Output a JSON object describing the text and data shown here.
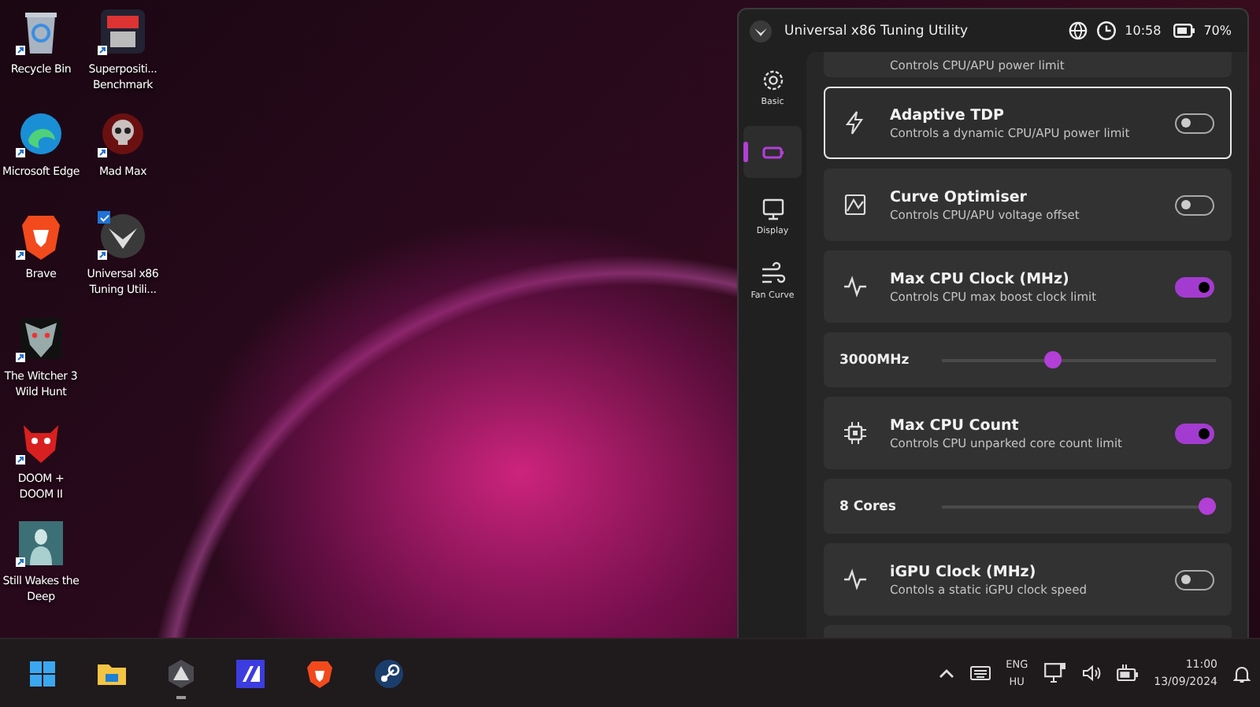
{
  "desktop": {
    "columns": [
      [
        {
          "label": "Recycle Bin",
          "selected": false
        },
        {
          "label": "Microsoft Edge",
          "selected": false
        },
        {
          "label": "Brave",
          "selected": false
        },
        {
          "label": "The Witcher 3 Wild Hunt",
          "selected": false
        },
        {
          "label": "DOOM + DOOM II",
          "selected": false
        },
        {
          "label": "Still Wakes the Deep",
          "selected": false
        }
      ],
      [
        {
          "label": "Superpositi... Benchmark",
          "selected": false
        },
        {
          "label": "Mad Max",
          "selected": false
        },
        {
          "label": "Universal x86 Tuning Utili...",
          "selected": true
        }
      ]
    ]
  },
  "window": {
    "title": "Universal x86 Tuning Utility",
    "time": "10:58",
    "battery": "70%",
    "sidebar": [
      {
        "label": "Basic",
        "selected": false
      },
      {
        "selected": true
      },
      {
        "label": "Display",
        "selected": false
      },
      {
        "label": "Fan Curve",
        "selected": false
      }
    ],
    "settings": [
      {
        "kind": "partial",
        "subtitle": "Controls CPU/APU power limit"
      },
      {
        "kind": "toggle",
        "title": "Adaptive TDP",
        "subtitle": "Controls a dynamic CPU/APU power limit",
        "on": false,
        "focused": true
      },
      {
        "kind": "toggle",
        "title": "Curve Optimiser",
        "subtitle": "Controls CPU/APU voltage offset",
        "on": false,
        "focused": false
      },
      {
        "kind": "toggle",
        "title": "Max CPU Clock (MHz)",
        "subtitle": "Controls CPU max boost clock limit",
        "on": true,
        "focused": false
      },
      {
        "kind": "slider",
        "reading": "3000MHz",
        "level": 0.4
      },
      {
        "kind": "toggle",
        "title": "Max CPU Count",
        "subtitle": "Controls CPU unparked core count limit",
        "on": true,
        "focused": false
      },
      {
        "kind": "slider",
        "reading": "8 Cores",
        "level": 1
      },
      {
        "kind": "toggle",
        "title": "iGPU Clock (MHz)",
        "subtitle": "Contols a static iGPU clock speed",
        "on": false,
        "focused": false
      },
      {
        "kind": "empty"
      }
    ]
  },
  "taskbar": {
    "apps": [
      {
        "running": false
      },
      {
        "running": false
      },
      {
        "running": true
      },
      {
        "running": false
      },
      {
        "running": false
      },
      {
        "running": false
      }
    ],
    "language": "ENG",
    "region": "HU",
    "clock": "11:00",
    "date": "13/09/2024"
  }
}
